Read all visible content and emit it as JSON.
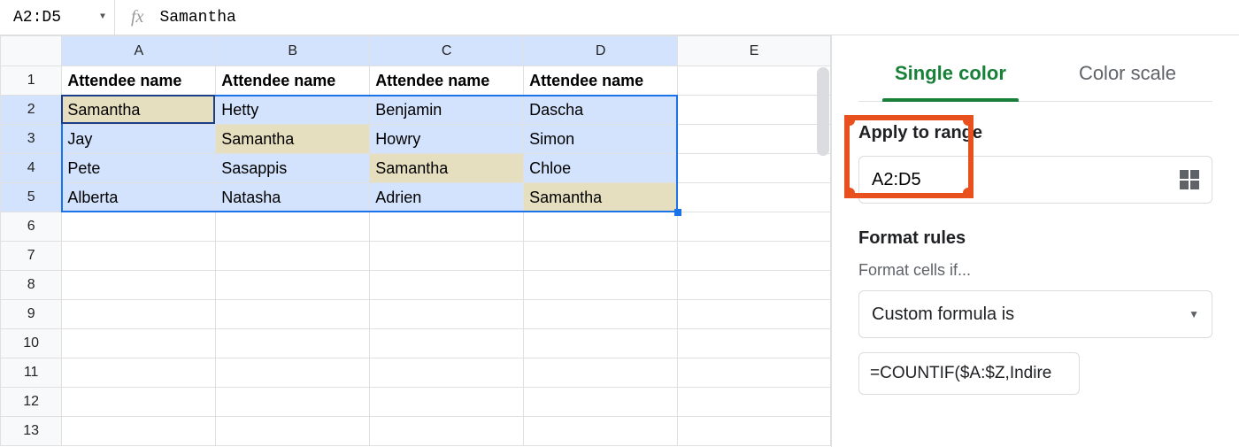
{
  "formula_bar": {
    "range_name": "A2:D5",
    "fx_label": "fx",
    "formula_value": "Samantha"
  },
  "sheet": {
    "columns": [
      "A",
      "B",
      "C",
      "D",
      "E"
    ],
    "rows": [
      "1",
      "2",
      "3",
      "4",
      "5",
      "6",
      "7",
      "8",
      "9",
      "10",
      "11",
      "12",
      "13"
    ],
    "headers": [
      "Attendee name",
      "Attendee name",
      "Attendee name",
      "Attendee name"
    ],
    "data": [
      [
        "Samantha",
        "Hetty",
        "Benjamin",
        "Dascha"
      ],
      [
        "Jay",
        "Samantha",
        "Howry",
        "Simon"
      ],
      [
        "Pete",
        "Sasappis",
        "Samantha",
        "Chloe"
      ],
      [
        "Alberta",
        "Natasha",
        "Adrien",
        "Samantha"
      ]
    ],
    "highlight_value": "Samantha",
    "selection": "A2:D5",
    "active_cell": "A2"
  },
  "sidebar": {
    "tabs": {
      "single": "Single color",
      "scale": "Color scale"
    },
    "apply_to_range_label": "Apply to range",
    "range_value": "A2:D5",
    "format_rules_label": "Format rules",
    "format_cells_if_label": "Format cells if...",
    "rule_type": "Custom formula is",
    "formula_value": "=COUNTIF($A:$Z,Indire"
  }
}
